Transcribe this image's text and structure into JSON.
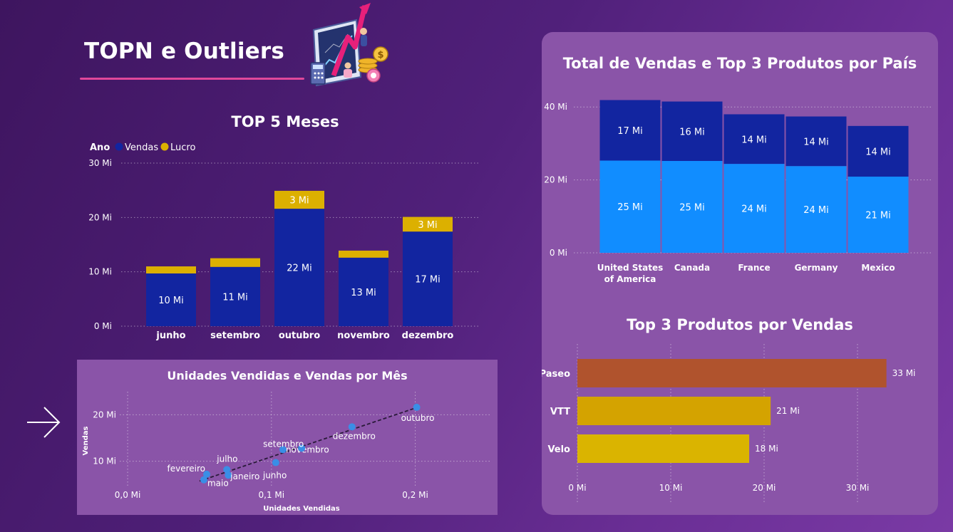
{
  "page": {
    "title": "TOPN e Outliers"
  },
  "months_chart": {
    "title": "TOP 5 Meses",
    "legend": {
      "label": "Ano",
      "items": [
        "Vendas",
        "Lucro"
      ]
    },
    "y_ticks": [
      "30 Mi",
      "20 Mi",
      "10 Mi",
      "0 Mi"
    ],
    "bar_labels": [
      "10 Mi",
      "11 Mi",
      "22 Mi",
      "13 Mi",
      "17 Mi"
    ],
    "lucro_labels": [
      "",
      "",
      "3 Mi",
      "",
      "3 Mi"
    ]
  },
  "country_chart": {
    "title": "Total de Vendas e Top 3 Produtos por País",
    "y_ticks": [
      "40 Mi",
      "20 Mi",
      "0 Mi"
    ],
    "top_labels": [
      "17 Mi",
      "16 Mi",
      "14 Mi",
      "14 Mi",
      "14 Mi"
    ],
    "bottom_labels": [
      "25 Mi",
      "25 Mi",
      "24 Mi",
      "24 Mi",
      "21 Mi"
    ]
  },
  "products_chart": {
    "title": "Top 3 Produtos por Vendas",
    "x_ticks": [
      "0 Mi",
      "10 Mi",
      "20 Mi",
      "30 Mi"
    ],
    "value_labels": [
      "33 Mi",
      "21 Mi",
      "18 Mi"
    ]
  },
  "scatter_chart": {
    "title": "Unidades Vendidas e Vendas por Mês",
    "xlabel": "Unidades Vendidas",
    "ylabel": "Vendas",
    "x_ticks": [
      "0,0 Mi",
      "0,1 Mi",
      "0,2 Mi"
    ],
    "y_ticks": [
      "20 Mi",
      "10 Mi"
    ]
  },
  "icons": {
    "next_arrow": "arrow-right-icon",
    "hero": "finance-growth-illustration"
  },
  "colors": {
    "background": "#50207a",
    "panel": "#8a54a8",
    "vendas_dark": "#1225a0",
    "vendas_light": "#118dff",
    "lucro": "#dcb000",
    "paseo": "#b0532d",
    "vtt": "#d4a300",
    "velo": "#dab400",
    "accent_line": "#e0489a",
    "scatter_dot": "#3a8ee6"
  },
  "chart_data": [
    {
      "type": "bar",
      "title": "TOP 5 Meses",
      "stacked": true,
      "categories": [
        "junho",
        "setembro",
        "outubro",
        "novembro",
        "dezembro"
      ],
      "series": [
        {
          "name": "Vendas",
          "values": [
            9.7,
            10.9,
            21.6,
            12.6,
            17.4
          ]
        },
        {
          "name": "Lucro",
          "values": [
            1.3,
            1.6,
            3.3,
            1.3,
            2.7
          ]
        }
      ],
      "legend_title": "Ano",
      "ylim": [
        0,
        30
      ],
      "y_ticks": [
        0,
        10,
        20,
        30
      ],
      "legend_position": "top-left",
      "grid": true
    },
    {
      "type": "bar",
      "title": "Total de Vendas e Top 3 Produtos por País",
      "stacked": true,
      "categories": [
        "United States of America",
        "Canada",
        "France",
        "Germany",
        "Mexico"
      ],
      "series": [
        {
          "values": [
            25.3,
            25.2,
            24.4,
            23.8,
            20.9
          ]
        },
        {
          "values": [
            16.6,
            16.3,
            13.6,
            13.6,
            13.9
          ]
        }
      ],
      "ylim": [
        0,
        42
      ],
      "y_ticks": [
        0,
        20,
        40
      ],
      "grid": true
    },
    {
      "type": "bar",
      "orientation": "horizontal",
      "title": "Top 3 Produtos por Vendas",
      "categories": [
        "Paseo",
        "VTT",
        "Velo"
      ],
      "values": [
        33.1,
        20.7,
        18.4
      ],
      "xlim": [
        0,
        35
      ],
      "x_ticks": [
        0,
        10,
        20,
        30
      ],
      "grid": true
    },
    {
      "type": "scatter",
      "title": "Unidades Vendidas e Vendas por Mês",
      "xlabel": "Unidades Vendidas",
      "ylabel": "Vendas",
      "points": [
        {
          "label": "fevereiro",
          "x": 0.055,
          "y": 7.2
        },
        {
          "label": "maio",
          "x": 0.053,
          "y": 6.0
        },
        {
          "label": "janeiro",
          "x": 0.07,
          "y": 7.0
        },
        {
          "label": "julho",
          "x": 0.069,
          "y": 8.2
        },
        {
          "label": "junho",
          "x": 0.103,
          "y": 9.7
        },
        {
          "label": "novembro",
          "x": 0.108,
          "y": 12.5
        },
        {
          "label": "setembro",
          "x": 0.121,
          "y": 12.8
        },
        {
          "label": "dezembro",
          "x": 0.156,
          "y": 17.4
        },
        {
          "label": "outubro",
          "x": 0.201,
          "y": 21.6
        }
      ],
      "trendline": true,
      "xlim": [
        -0.003,
        0.225
      ],
      "ylim": [
        3.5,
        24.5
      ],
      "x_ticks": [
        0.0,
        0.1,
        0.2
      ],
      "y_ticks": [
        10,
        20
      ],
      "grid": true
    }
  ]
}
